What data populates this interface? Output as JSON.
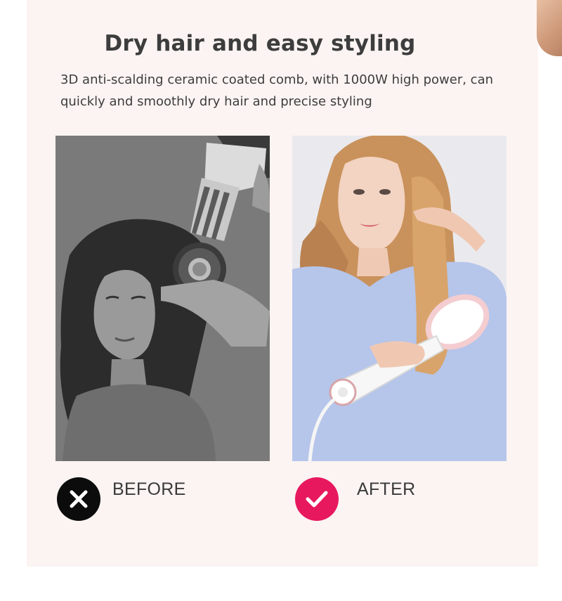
{
  "header": {
    "title": "Dry hair and easy styling",
    "subtitle": "3D anti-scalding ceramic coated comb, with 1000W high power, can quickly and smoothly dry hair and precise styling"
  },
  "comparison": {
    "before": {
      "label": "BEFORE",
      "icon": "close-icon",
      "icon_color": "#0c0c0c"
    },
    "after": {
      "label": "AFTER",
      "icon": "check-icon",
      "icon_color": "#e8185f"
    }
  },
  "colors": {
    "panel_background": "#fbf4f2",
    "text": "#3d3d3d",
    "accent": "#e8185f"
  }
}
